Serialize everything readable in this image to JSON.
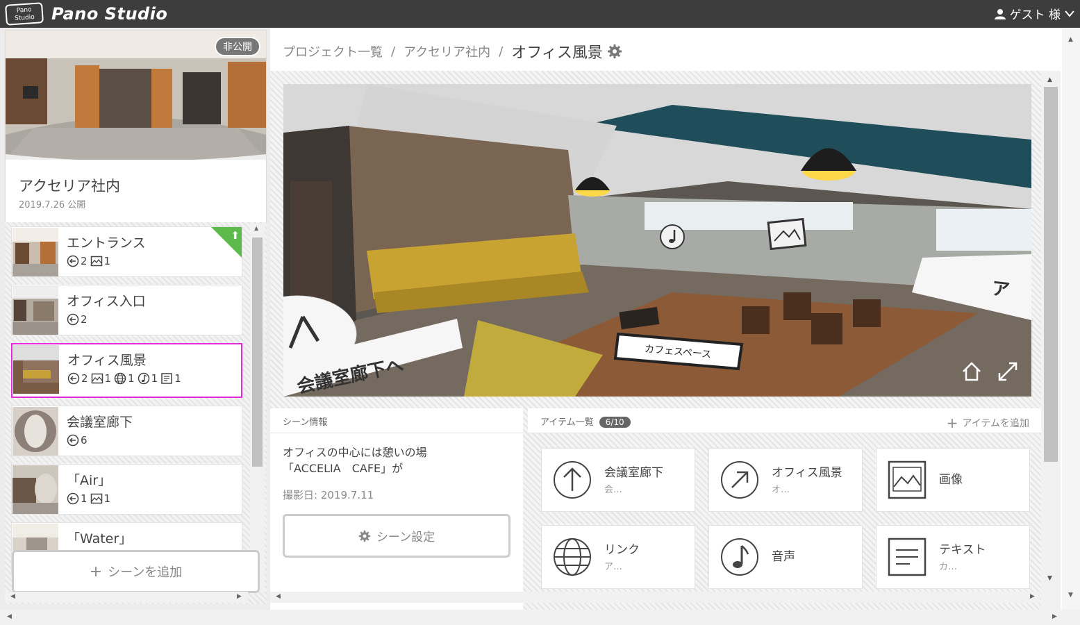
{
  "header": {
    "logo_badge": "Pano Studio",
    "logo_text": "Pano Studio",
    "user_label": "ゲスト 様"
  },
  "project": {
    "status_badge": "非公開",
    "title": "アクセリア社内",
    "date": "2019.7.26 公開"
  },
  "scenes": [
    {
      "name": "エントランス",
      "meta": [
        {
          "icon": "link-arrow-icon",
          "count": "2"
        },
        {
          "icon": "image-icon",
          "count": "1"
        }
      ],
      "start_scene": true
    },
    {
      "name": "オフィス入口",
      "meta": [
        {
          "icon": "link-arrow-icon",
          "count": "2"
        }
      ]
    },
    {
      "name": "オフィス風景",
      "selected": true,
      "meta": [
        {
          "icon": "link-arrow-icon",
          "count": "2"
        },
        {
          "icon": "image-icon",
          "count": "1"
        },
        {
          "icon": "globe-icon",
          "count": "1"
        },
        {
          "icon": "music-icon",
          "count": "1"
        },
        {
          "icon": "text-icon",
          "count": "1"
        }
      ]
    },
    {
      "name": "会議室廊下",
      "meta": [
        {
          "icon": "link-arrow-icon",
          "count": "6"
        }
      ]
    },
    {
      "name": "「Air」",
      "meta": [
        {
          "icon": "link-arrow-icon",
          "count": "1"
        },
        {
          "icon": "image-icon",
          "count": "1"
        }
      ]
    },
    {
      "name": "「Water」",
      "meta": []
    }
  ],
  "add_scene_label": "シーンを追加",
  "breadcrumb": {
    "items": [
      "プロジェクト一覧",
      "アクセリア社内"
    ],
    "separator": "/",
    "current": "オフィス風景"
  },
  "viewer": {
    "hotspot_forward": "会議室廊下へ",
    "hotspot_right": "ア",
    "cafe_label": "カフェスペース"
  },
  "scene_info": {
    "header": "シーン情報",
    "description_line1": "オフィスの中心には憩いの場",
    "description_line2": "「ACCELIA　CAFE」が",
    "shooting_date": "撮影日: 2019.7.11",
    "settings_button": "シーン設定"
  },
  "items_panel": {
    "header": "アイテム一覧",
    "count": "6/10",
    "add_label": "アイテムを追加",
    "items": [
      {
        "icon": "arrow-up-circle-icon",
        "title": "会議室廊下",
        "sub": "会…"
      },
      {
        "icon": "arrow-diag-circle-icon",
        "title": "オフィス風景",
        "sub": "オ…"
      },
      {
        "icon": "image-icon",
        "title": "画像",
        "sub": ""
      },
      {
        "icon": "globe-icon",
        "title": "リンク",
        "sub": "ア…"
      },
      {
        "icon": "music-icon",
        "title": "音声",
        "sub": ""
      },
      {
        "icon": "text-icon",
        "title": "テキスト",
        "sub": "カ…"
      }
    ]
  },
  "colors": {
    "topbar": "#3d3d3d",
    "selected_border": "#e12bd8",
    "start_flag": "#5cbb4b"
  }
}
